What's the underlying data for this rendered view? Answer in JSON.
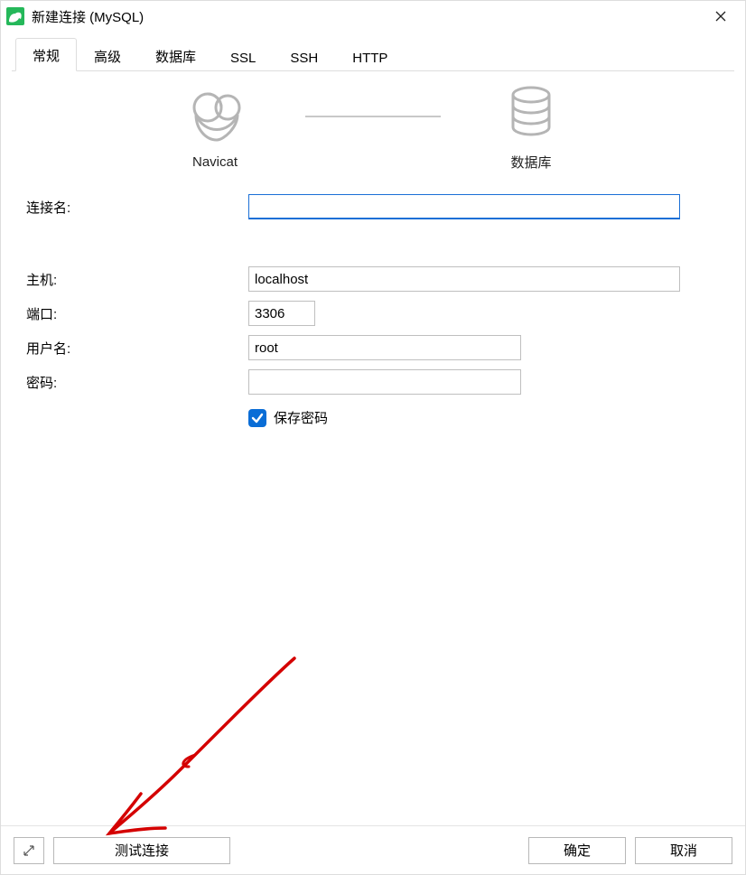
{
  "window": {
    "title": "新建连接 (MySQL)"
  },
  "tabs": {
    "general": "常规",
    "advanced": "高级",
    "databases": "数据库",
    "ssl": "SSL",
    "ssh": "SSH",
    "http": "HTTP"
  },
  "diagram": {
    "left_label": "Navicat",
    "right_label": "数据库"
  },
  "form": {
    "conn_name_label": "连接名:",
    "conn_name_value": "",
    "host_label": "主机:",
    "host_value": "localhost",
    "port_label": "端口:",
    "port_value": "3306",
    "user_label": "用户名:",
    "user_value": "root",
    "password_label": "密码:",
    "password_value": "",
    "save_password_label": "保存密码",
    "save_password_checked": true
  },
  "footer": {
    "test_connection": "测试连接",
    "ok": "确定",
    "cancel": "取消"
  }
}
